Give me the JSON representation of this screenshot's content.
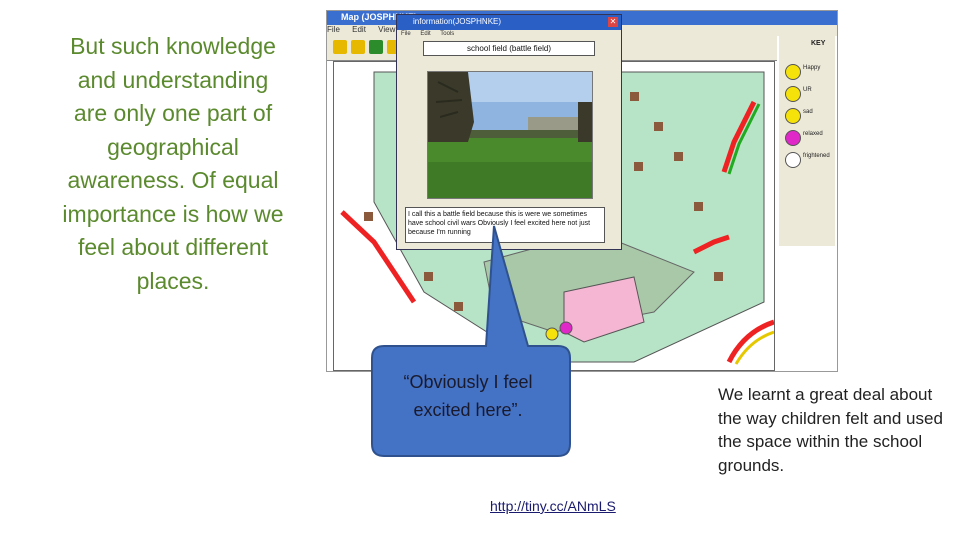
{
  "left_text": "But such knowledge and understanding are only one part of geographical awareness. Of equal importance is how we feel about different places.",
  "right_text": "We learnt a great deal about the way children felt and used the space within the school grounds.",
  "callout_quote": "“Obviously I feel excited here”.",
  "link": "http://tiny.cc/ANmLS",
  "screenshot": {
    "main_title": "Map (JOSPHNKE)",
    "menu": [
      "File",
      "Edit",
      "View"
    ],
    "key_title": "KEY",
    "key_items": [
      {
        "label": "Happy",
        "color": "#f5e20a"
      },
      {
        "label": "UR",
        "color": "#f5e20a"
      },
      {
        "label": "sad",
        "color": "#f5e20a"
      },
      {
        "label": "relaxed",
        "color": "#e028c8"
      },
      {
        "label": "frightened",
        "color": "#ffffff"
      }
    ],
    "popup_title": "information(JOSPHNKE)",
    "popup_menu": [
      "File",
      "Edit",
      "Tools"
    ],
    "place_name": "school field (battle field)",
    "comment": "I call this a battle field because this is were we sometimes have school civil wars Obviously I feel excited here not just because I'm running"
  },
  "colors": {
    "heading_green": "#5b8a2e",
    "callout_blue": "#4472c4",
    "map_green": "#b7e4c7",
    "map_pink": "#f4b6d2"
  }
}
